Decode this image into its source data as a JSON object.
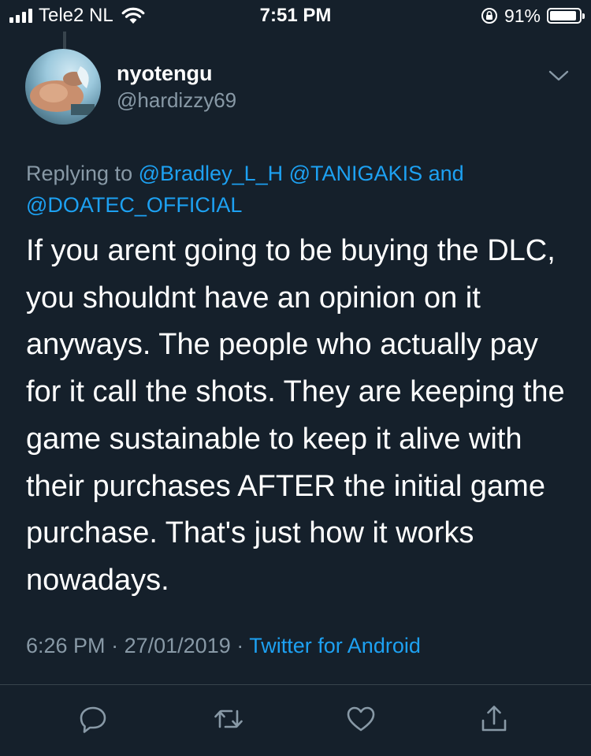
{
  "status_bar": {
    "carrier": "Tele2 NL",
    "time": "7:51 PM",
    "battery_percent": "91%",
    "battery_level": 0.91,
    "signal_bars": 4
  },
  "tweet": {
    "display_name": "nyotengu",
    "handle": "@hardizzy69",
    "replying_prefix": "Replying to",
    "mentions": [
      "@Bradley_L_H",
      "@TANIGAKIS",
      "@DOATEC_OFFICIAL"
    ],
    "mentions_joiner": "and",
    "text": "If you arent going to be buying the DLC, you shouldnt have an opinion on it anyways. The people who actually pay for it call the shots. They are keeping the game sustainable to keep it alive with their purchases AFTER the initial game purchase. That's just how it works nowadays.",
    "time": "6:26 PM",
    "date": "27/01/2019",
    "separator": "·",
    "source": "Twitter for Android"
  },
  "actions": {
    "icons": [
      "reply-icon",
      "retweet-icon",
      "like-icon",
      "share-icon"
    ]
  },
  "colors": {
    "background": "#15202b",
    "accent": "#1da1f2",
    "secondary_text": "#8899a6",
    "divider": "#38444d"
  }
}
